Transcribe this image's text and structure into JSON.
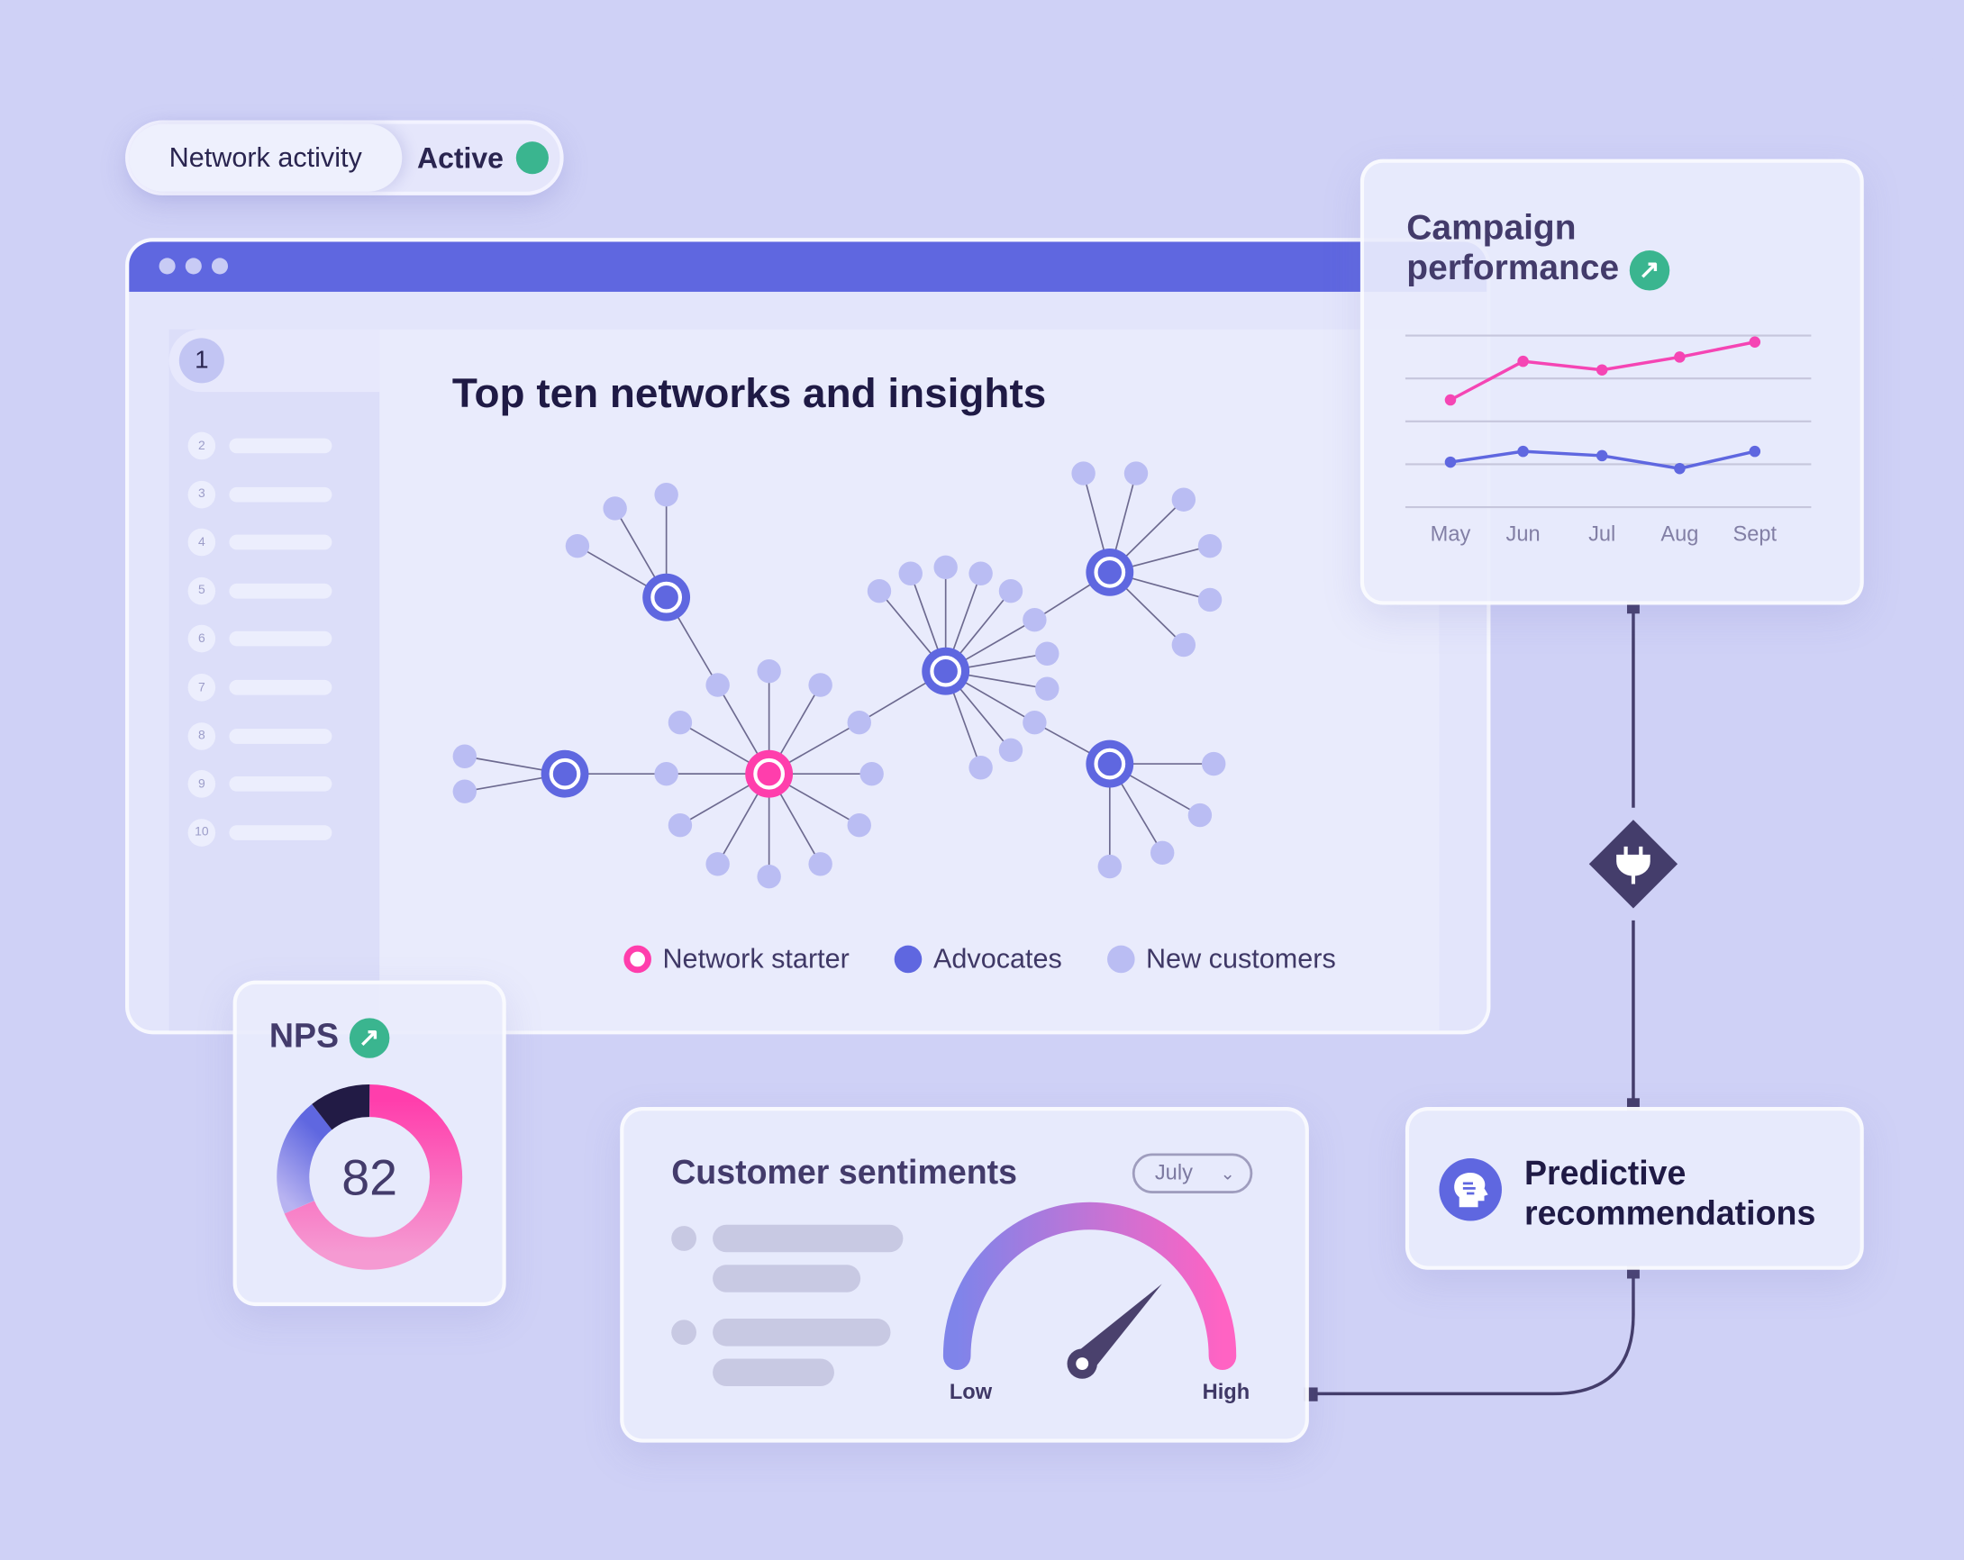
{
  "pill": {
    "label": "Network activity",
    "status": "Active",
    "status_color": "#3ab58f"
  },
  "window": {
    "selected_item": "1",
    "items": [
      "2",
      "3",
      "4",
      "5",
      "6",
      "7",
      "8",
      "9",
      "10"
    ],
    "title": "Top ten networks and insights",
    "legend": [
      {
        "label": "Network starter",
        "color": "#ff3eac"
      },
      {
        "label": "Advocates",
        "color": "#5f67e0"
      },
      {
        "label": "New customers",
        "color": "#babdf3"
      }
    ]
  },
  "campaign": {
    "title_line1": "Campaign",
    "title_line2": "performance",
    "trend_icon": "arrow-up-right-icon",
    "chart_data": {
      "type": "line",
      "categories": [
        "May",
        "Jun",
        "Jul",
        "Aug",
        "Sept"
      ],
      "ylim": [
        0,
        4
      ],
      "grid": true,
      "series": [
        {
          "color": "#f545b4",
          "values": [
            2.5,
            3.4,
            3.2,
            3.5,
            3.85
          ]
        },
        {
          "color": "#5f67e0",
          "values": [
            1.05,
            1.3,
            1.2,
            0.9,
            1.3
          ]
        }
      ]
    }
  },
  "nps": {
    "title": "NPS",
    "value": "82",
    "trend_icon": "arrow-up-right-icon"
  },
  "sentiment": {
    "title": "Customer sentiments",
    "dropdown": "July",
    "low": "Low",
    "high": "High",
    "gauge_level": 0.75
  },
  "predictive": {
    "line1": "Predictive",
    "line2": "recommendations",
    "icon": "head-brain-icon"
  },
  "connector_icon": "plug-icon"
}
